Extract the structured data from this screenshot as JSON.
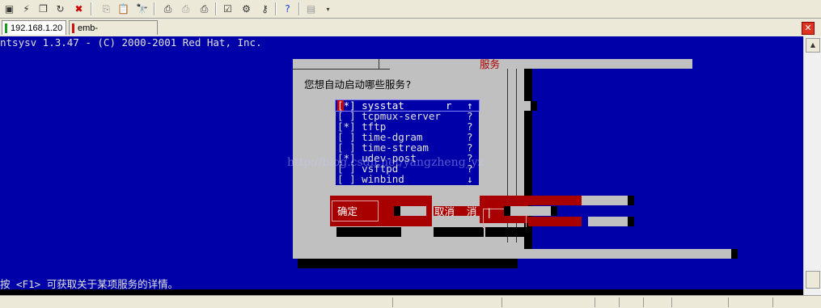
{
  "toolbar": {
    "icons": [
      "new-session-icon",
      "quick-connect-icon",
      "copy-icon",
      "reconnect-icon",
      "disconnect-icon",
      "copy-text-icon",
      "paste-icon",
      "find-icon",
      "print-icon",
      "print-setup-icon",
      "print-screen-icon",
      "session-options-icon",
      "global-options-icon",
      "key-icon",
      "help-icon",
      "window-icon",
      "more-icon"
    ]
  },
  "tabs": [
    {
      "label": "192.168.1.20",
      "color": "#1a9a1a"
    },
    {
      "label": "emb-lingyun.xicp.net",
      "color": "#cc1111"
    }
  ],
  "terminal": {
    "header": "ntsysv 1.3.47 - (C) 2000-2001 Red Hat, Inc.",
    "dialog_title": "服务",
    "prompt": "您想自动启动哪些服务?",
    "services": [
      {
        "mark": "*",
        "name": "sysstat",
        "right": "r",
        "scroll": "↑"
      },
      {
        "mark": " ",
        "name": "tcpmux-server",
        "right": "",
        "scroll": "?"
      },
      {
        "mark": "*",
        "name": "tftp",
        "right": "",
        "scroll": "?"
      },
      {
        "mark": " ",
        "name": "time-dgram",
        "right": "",
        "scroll": "?"
      },
      {
        "mark": " ",
        "name": "time-stream",
        "right": "",
        "scroll": "?"
      },
      {
        "mark": "*",
        "name": "udev-post",
        "right": "",
        "scroll": "?"
      },
      {
        "mark": " ",
        "name": "vsftpd",
        "right": "",
        "scroll": "?"
      },
      {
        "mark": " ",
        "name": "winbind",
        "right": "",
        "scroll": "↓"
      }
    ],
    "ok_label": "确定",
    "cancel_label": "取消",
    "cancel_echo": "消",
    "footer": "按 <F1> 可获取关于某项服务的详情。",
    "watermark": "http://blog.csdn.net/yangzheng_yz"
  },
  "colors": {
    "terminal_bg": "#0000a8",
    "dialog": "#c0c0c0",
    "button": "#a80000",
    "title": "#a80000"
  }
}
